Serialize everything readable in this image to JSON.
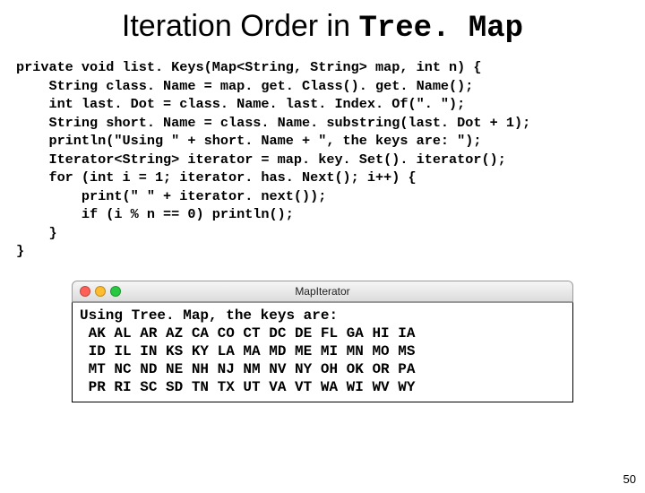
{
  "title": {
    "prefix": "Iteration Order in ",
    "mono": "Tree. Map"
  },
  "code_lines": [
    "private void list. Keys(Map<String, String> map, int n) {",
    "    String class. Name = map. get. Class(). get. Name();",
    "    int last. Dot = class. Name. last. Index. Of(\". \");",
    "    String short. Name = class. Name. substring(last. Dot + 1);",
    "    println(\"Using \" + short. Name + \", the keys are: \");",
    "    Iterator<String> iterator = map. key. Set(). iterator();",
    "    for (int i = 1; iterator. has. Next(); i++) {",
    "        print(\" \" + iterator. next());",
    "        if (i % n == 0) println();",
    "    }",
    "}"
  ],
  "console": {
    "window_title": "MapIterator",
    "lines": [
      "Using Tree. Map, the keys are:",
      " AK AL AR AZ CA CO CT DC DE FL GA HI IA",
      " ID IL IN KS KY LA MA MD ME MI MN MO MS",
      " MT NC ND NE NH NJ NM NV NY OH OK OR PA",
      " PR RI SC SD TN TX UT VA VT WA WI WV WY"
    ]
  },
  "page_number": "50"
}
